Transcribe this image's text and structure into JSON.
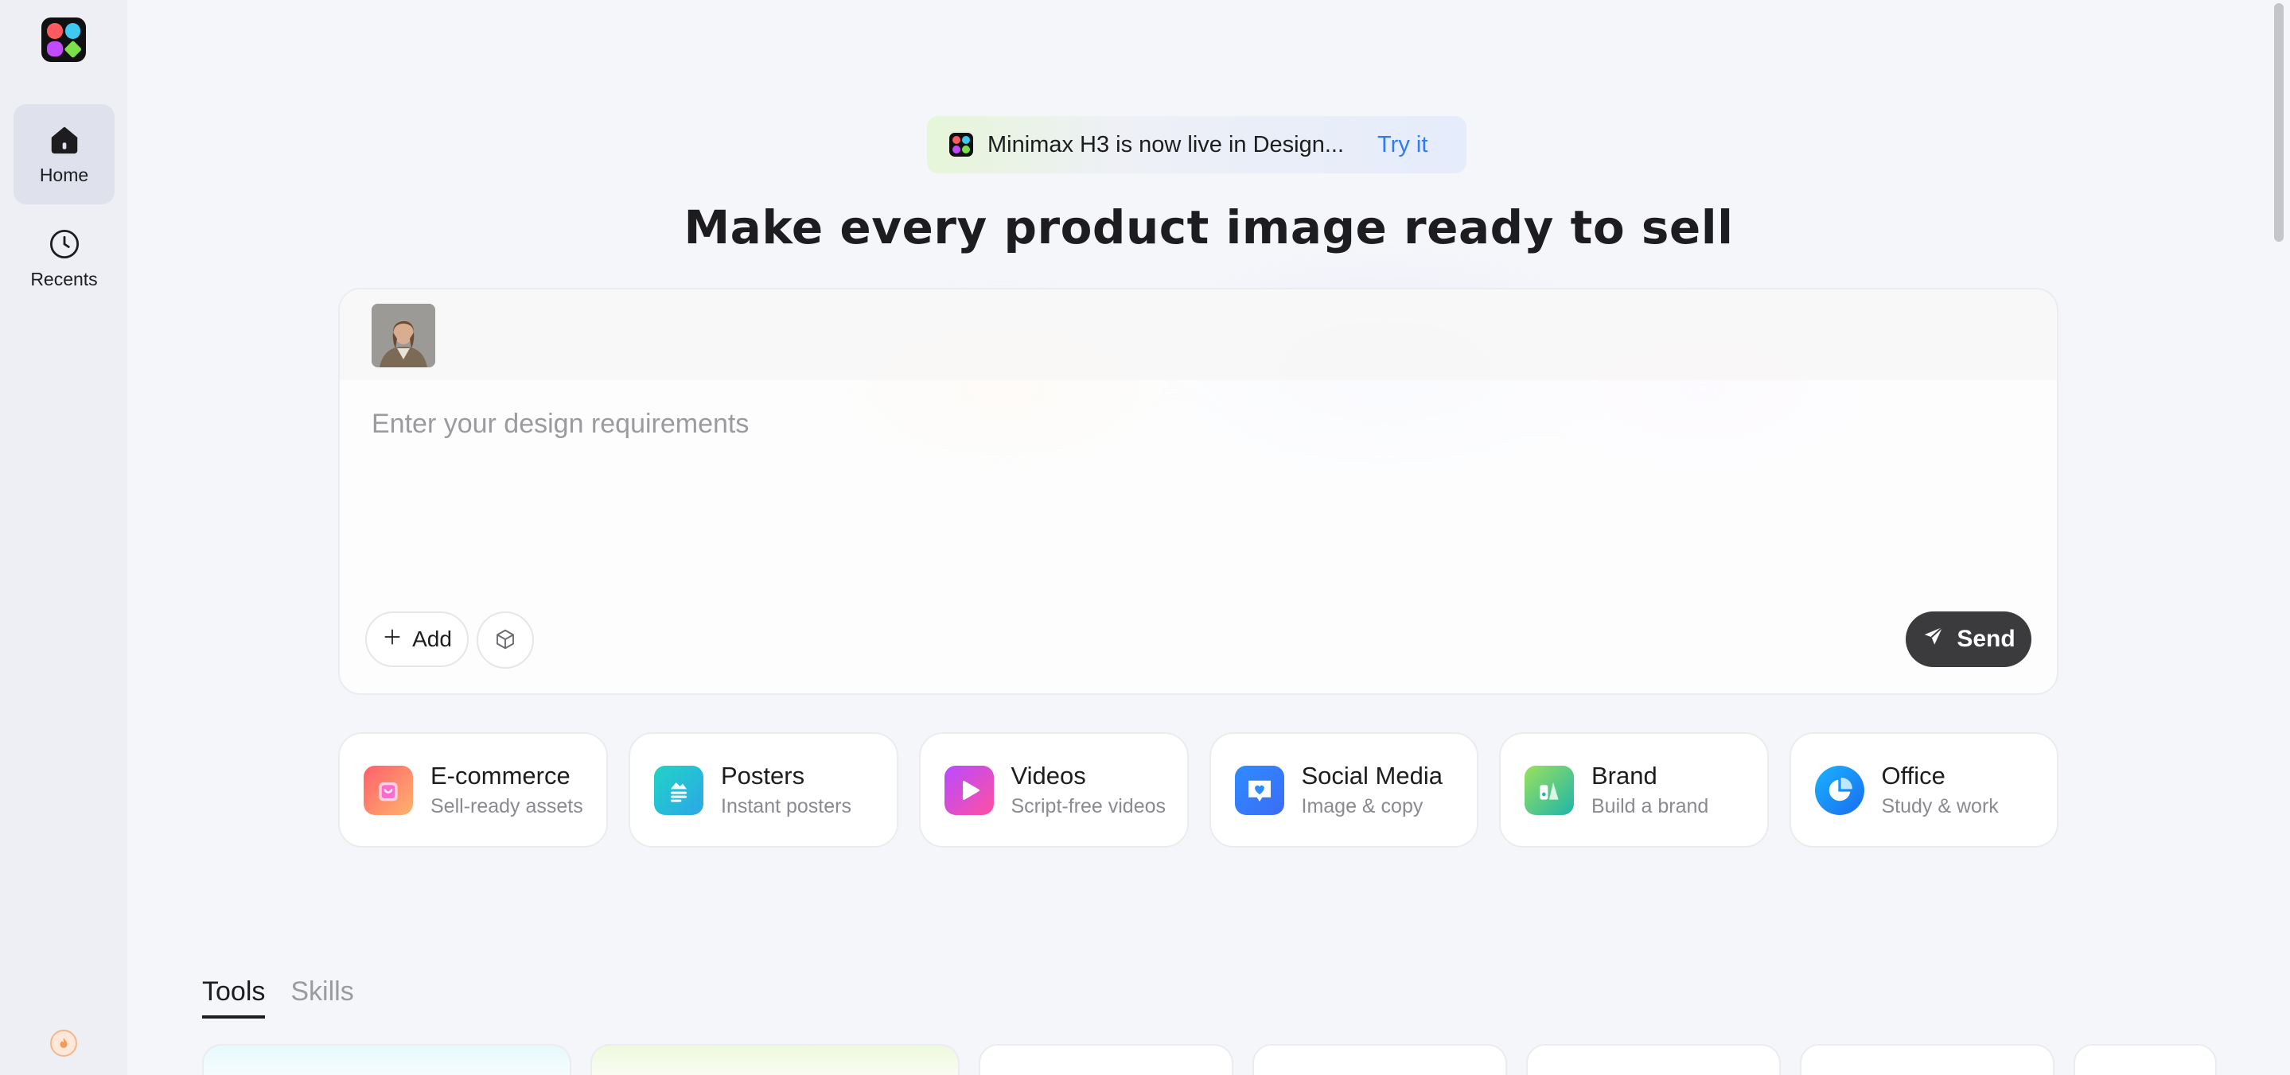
{
  "sidebar": {
    "items": [
      {
        "label": "Home",
        "icon": "home-icon",
        "active": true
      },
      {
        "label": "Recents",
        "icon": "clock-icon",
        "active": false
      }
    ]
  },
  "banner": {
    "text": "Minimax H3 is now live in Design...",
    "link": "Try it"
  },
  "headline": "Make every product image ready to sell",
  "composer": {
    "placeholder": "Enter your design requirements",
    "add_label": "Add",
    "send_label": "Send"
  },
  "categories": [
    {
      "title": "E-commerce",
      "subtitle": "Sell-ready assets",
      "icon": "shopping-bag-icon",
      "color": "#ff7a59"
    },
    {
      "title": "Posters",
      "subtitle": "Instant posters",
      "icon": "poster-icon",
      "color": "#1ec3d8"
    },
    {
      "title": "Videos",
      "subtitle": "Script-free videos",
      "icon": "play-icon",
      "color": "#d64bf0"
    },
    {
      "title": "Social Media",
      "subtitle": "Image & copy",
      "icon": "heart-chat-icon",
      "color": "#2f8cff"
    },
    {
      "title": "Brand",
      "subtitle": "Build a brand",
      "icon": "brand-icon",
      "color": "#3cc47a"
    },
    {
      "title": "Office",
      "subtitle": "Study & work",
      "icon": "pie-chart-icon",
      "color": "#1a8cff"
    }
  ],
  "tabs": [
    {
      "label": "Tools",
      "active": true
    },
    {
      "label": "Skills",
      "active": false
    }
  ],
  "colors": {
    "accent_link": "#2f7cf6",
    "send_button": "#3b3b3d",
    "sidebar_bg": "#eeeff4",
    "page_bg": "#f5f6fa"
  }
}
